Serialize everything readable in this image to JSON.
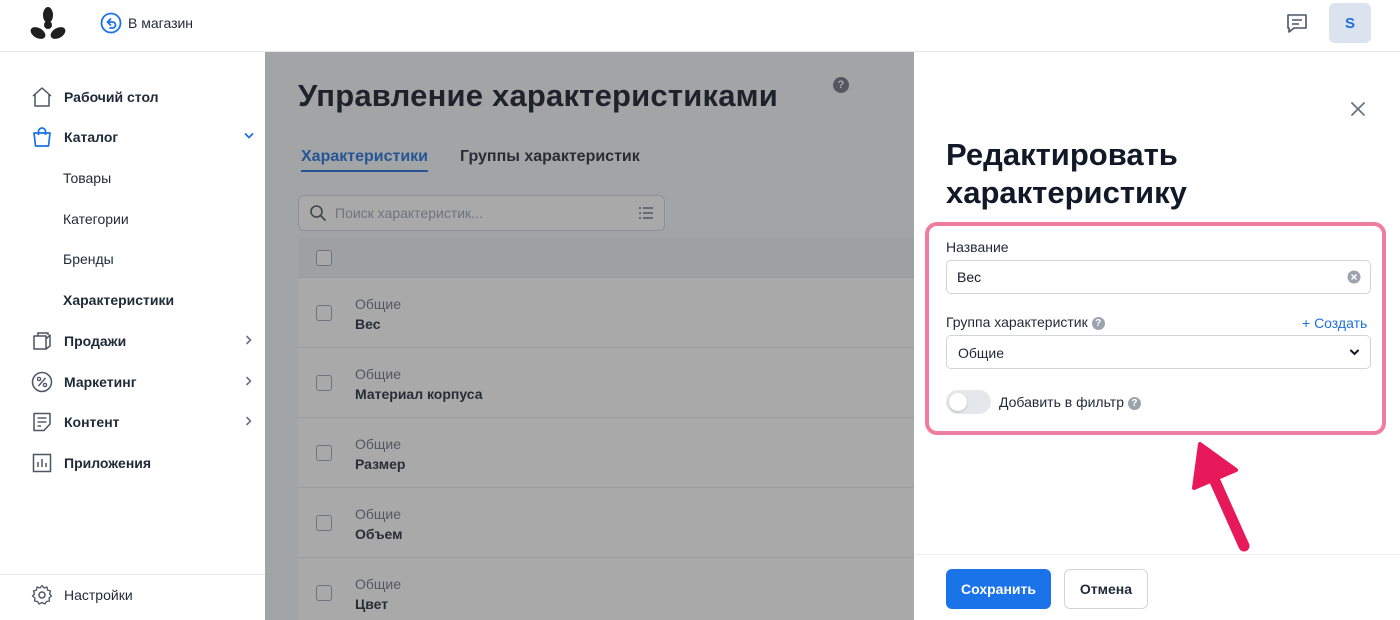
{
  "topbar": {
    "back_label": "В магазин",
    "avatar_initial": "S"
  },
  "sidebar": {
    "items": [
      {
        "label": "Рабочий стол",
        "icon": "home-icon"
      },
      {
        "label": "Каталог",
        "icon": "shopping-bag-icon",
        "expanded": true
      },
      {
        "label": "Продажи",
        "icon": "sales-icon"
      },
      {
        "label": "Маркетинг",
        "icon": "percent-icon"
      },
      {
        "label": "Контент",
        "icon": "content-icon"
      },
      {
        "label": "Приложения",
        "icon": "apps-chart-icon"
      }
    ],
    "catalog_subitems": [
      "Товары",
      "Категории",
      "Бренды",
      "Характеристики"
    ],
    "active_subitem": "Характеристики",
    "settings_label": "Настройки"
  },
  "main": {
    "title": "Управление характеристиками",
    "help_mark": "?",
    "tabs": [
      {
        "label": "Характеристики",
        "active": true
      },
      {
        "label": "Группы характеристик",
        "active": false
      }
    ],
    "search_placeholder": "Поиск характеристик...",
    "rows": [
      {
        "group": "Общие",
        "name": "Вес"
      },
      {
        "group": "Общие",
        "name": "Материал корпуса"
      },
      {
        "group": "Общие",
        "name": "Размер"
      },
      {
        "group": "Общие",
        "name": "Объем"
      },
      {
        "group": "Общие",
        "name": "Цвет"
      }
    ]
  },
  "panel": {
    "title": "Редактировать характеристику",
    "name_label": "Название",
    "name_value": "Вес",
    "group_label": "Группа характеристик",
    "help_mark": "?",
    "create_label": "+ Создать",
    "group_value": "Общие",
    "filter_label": "Добавить в фильтр",
    "filter_enabled": false,
    "save_label": "Сохранить",
    "cancel_label": "Отмена"
  },
  "colors": {
    "accent": "#1a73e8",
    "highlight": "#ee7d9f",
    "arrow": "#e8195a"
  }
}
